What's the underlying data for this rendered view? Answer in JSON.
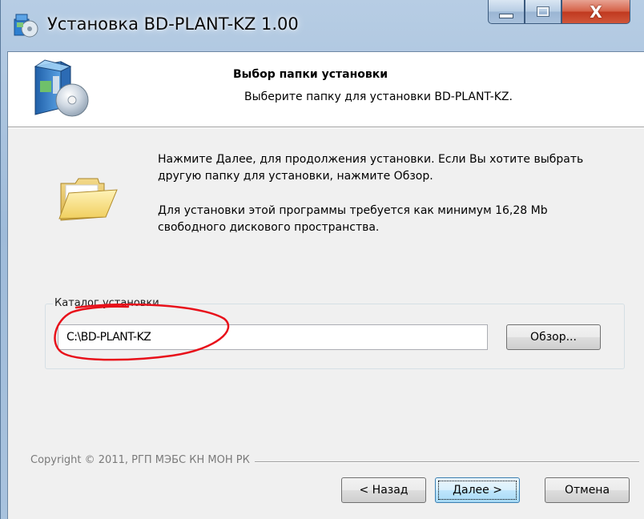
{
  "window": {
    "title": "Установка BD-PLANT-KZ 1.00",
    "minimize_icon": "minimize-icon",
    "maximize_icon": "maximize-icon",
    "close_icon": "close-icon",
    "close_glyph": "X"
  },
  "header": {
    "title": "Выбор папки установки",
    "subtitle": "Выберите папку для установки BD-PLANT-KZ.",
    "icon": "installer-cd-box-icon"
  },
  "body": {
    "info_line1": "Нажмите Далее, для продолжения установки. Если Вы хотите выбрать другую папку для установки, нажмите Обзор.",
    "info_line2": "Для установки этой программы требуется как минимум 16,28 Mb свободного дискового пространства.",
    "folder_icon": "folder-icon"
  },
  "install_dir": {
    "group_label": "Каталог установки",
    "value": "C:\\BD-PLANT-KZ",
    "browse_label": "Обзор..."
  },
  "footer": {
    "copyright": "Copyright © 2011, РГП МЭБС КН МОН РК",
    "back_label": "< Назад",
    "next_label": "Далее >",
    "cancel_label": "Отмена"
  },
  "colors": {
    "annotation_circle": "#e8101a",
    "close_button": "#c8442a",
    "focus_button_border": "#3c7fb1"
  }
}
